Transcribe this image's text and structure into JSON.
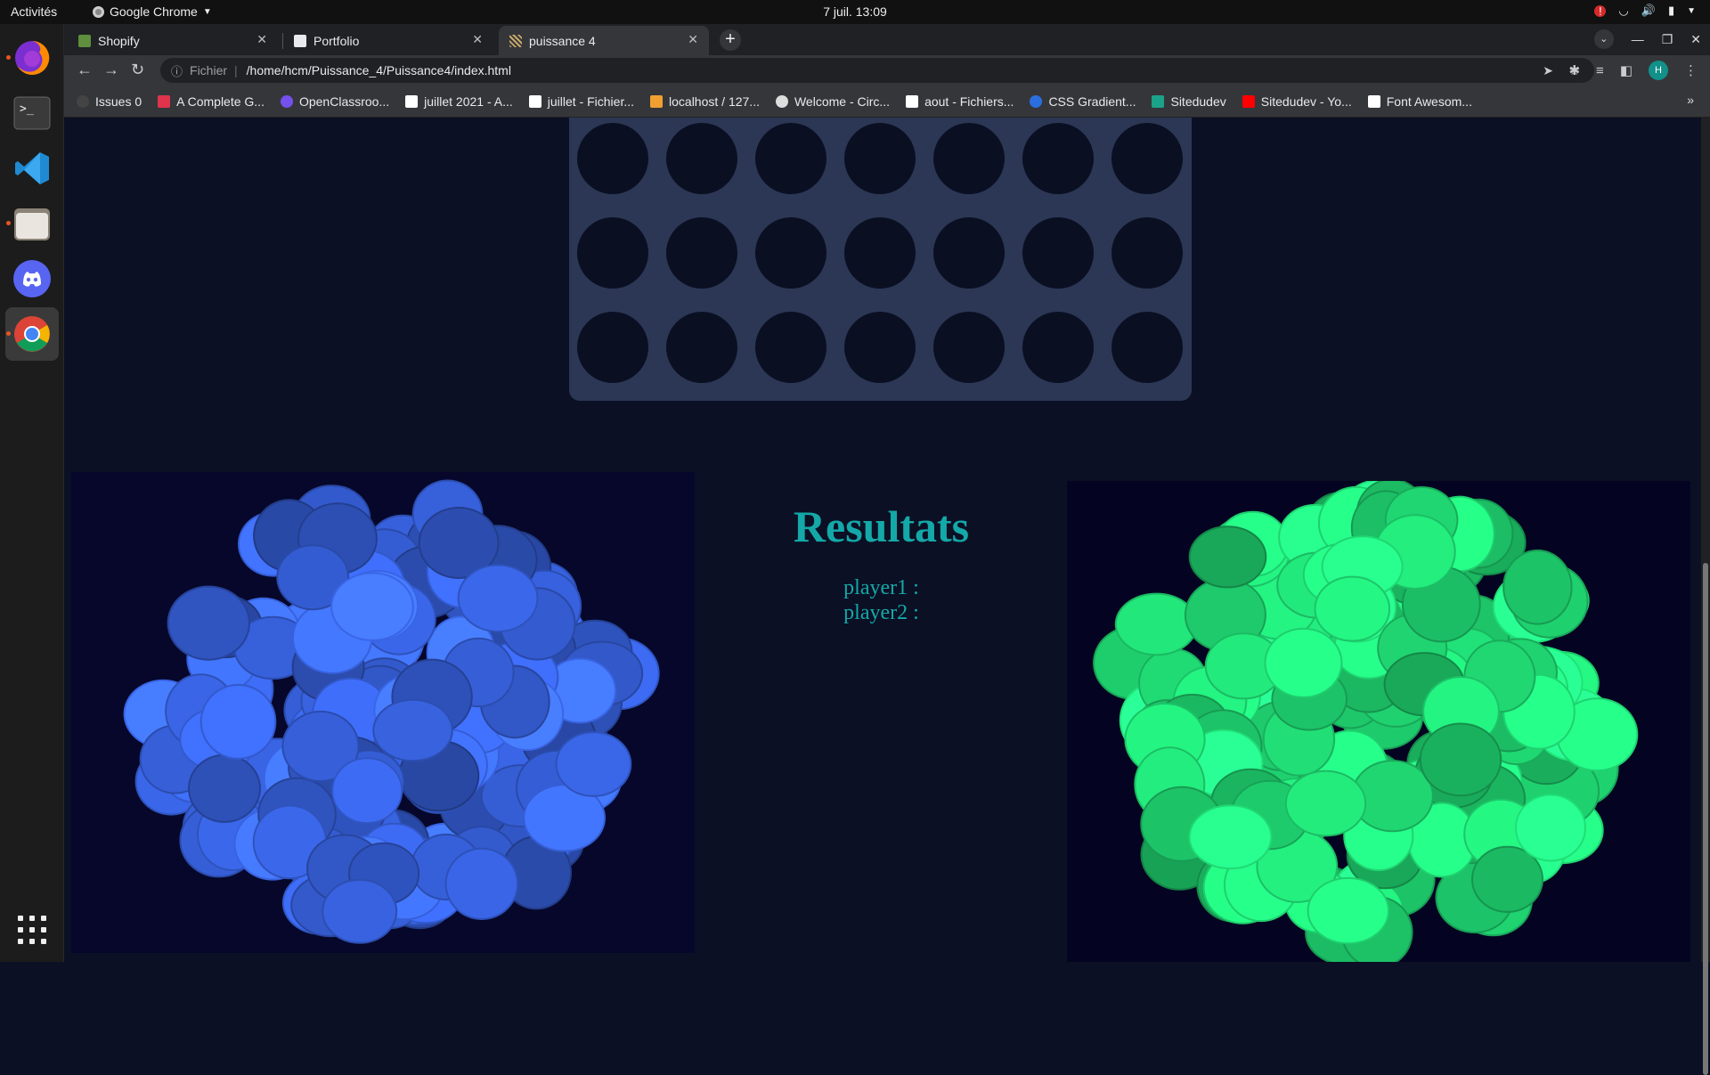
{
  "os": {
    "activities": "Activités",
    "app_name": "Google Chrome",
    "clock": "7 juil.  13:09",
    "alert_badge": "!"
  },
  "dock": {
    "items": [
      "firefox-icon",
      "terminal-icon",
      "vscode-icon",
      "files-icon",
      "discord-icon",
      "chrome-icon"
    ],
    "apps_icon": "show-apps-icon"
  },
  "browser": {
    "tabs": [
      {
        "label": "Shopify",
        "favicon_color": "#5e8e3e"
      },
      {
        "label": "Portfolio",
        "favicon_color": "#e8eaed"
      },
      {
        "label": "puissance 4",
        "favicon_color": "#c8a86b"
      }
    ],
    "address": {
      "scheme": "Fichier",
      "path": "/home/hcm/Puissance_4/Puissance4/index.html"
    },
    "profile_initial": "H",
    "bookmarks": [
      {
        "label": "Issues 0",
        "color": "#444"
      },
      {
        "label": "A Complete G...",
        "color": "#e0334c"
      },
      {
        "label": "OpenClassroo...",
        "color": "#7451eb"
      },
      {
        "label": "juillet 2021 - A...",
        "color": "#ffffff"
      },
      {
        "label": "juillet - Fichier...",
        "color": "#ffffff"
      },
      {
        "label": "localhost / 127...",
        "color": "#f0a030"
      },
      {
        "label": "Welcome - Circ...",
        "color": "#dddddd"
      },
      {
        "label": "aout - Fichiers...",
        "color": "#ffffff"
      },
      {
        "label": "CSS Gradient...",
        "color": "#2a6ee0"
      },
      {
        "label": "Sitedudev",
        "color": "#1ba38a"
      },
      {
        "label": "Sitedudev - Yo...",
        "color": "#ff0000"
      },
      {
        "label": "Font Awesom...",
        "color": "#ffffff"
      }
    ]
  },
  "game": {
    "board": {
      "columns": 7,
      "visible_rows": 3,
      "board_color": "#2c3755",
      "hole_color": "#0a1022"
    },
    "results": {
      "title": "Resultats",
      "player1": "player1 :",
      "player2": "player2 :"
    },
    "colors": {
      "player1_tokens": "#3a66e8",
      "player2_tokens": "#22e67a",
      "text_accent": "#14a8a8"
    }
  }
}
